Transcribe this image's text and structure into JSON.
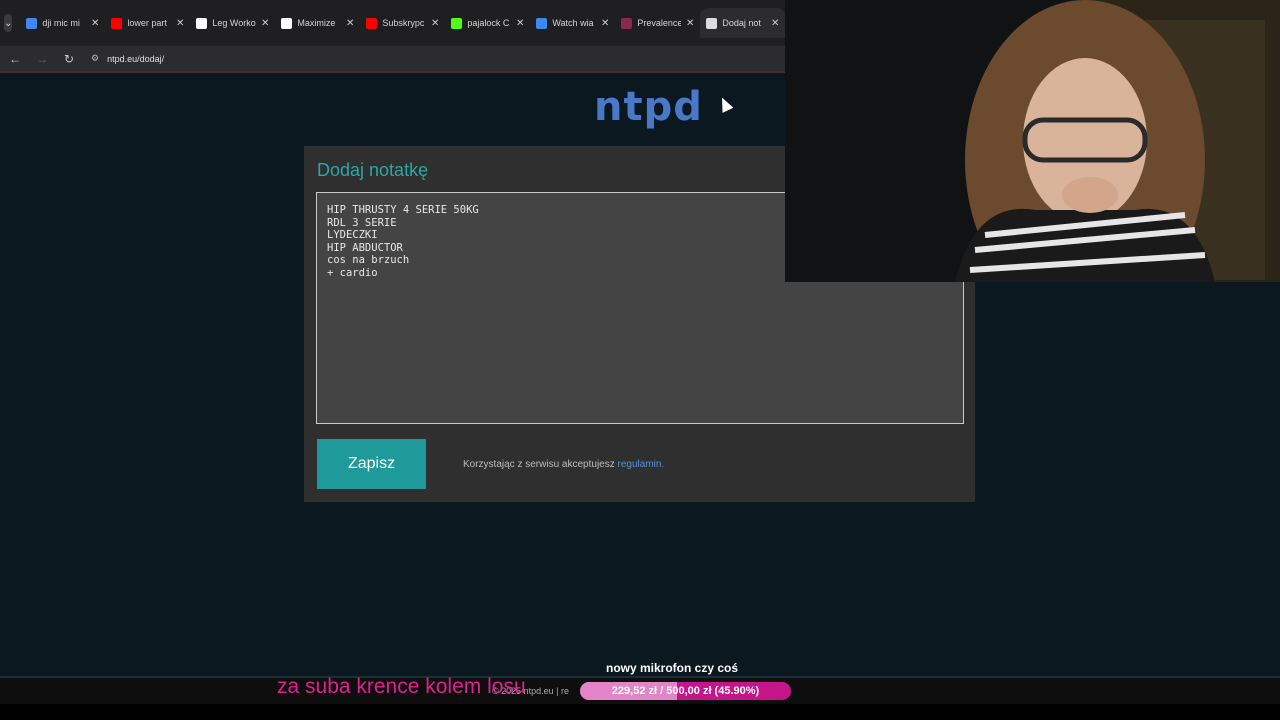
{
  "browser": {
    "tabs": [
      {
        "title": "dji mic mi",
        "favicon": "google-icon",
        "color": "#4285f4"
      },
      {
        "title": "lower part",
        "favicon": "youtube-icon",
        "color": "#ff0000"
      },
      {
        "title": "Leg Worko",
        "favicon": "tiktok-icon",
        "color": "#ffffff"
      },
      {
        "title": "Maximize",
        "favicon": "tiktok-icon",
        "color": "#ffffff"
      },
      {
        "title": "Subskrypc",
        "favicon": "youtube-icon",
        "color": "#ff0000"
      },
      {
        "title": "pajalock C",
        "favicon": "kick-icon",
        "color": "#53fc18"
      },
      {
        "title": "Watch wia",
        "favicon": "globe-icon",
        "color": "#3a8cf0"
      },
      {
        "title": "Prevalence",
        "favicon": "site-icon",
        "color": "#8a2a4a"
      },
      {
        "title": "Dodaj not",
        "favicon": "page-icon",
        "color": "#dddddd",
        "active": true
      }
    ],
    "close_glyph": "✕",
    "url": "ntpd.eu/dodaj/"
  },
  "page": {
    "logo": "ntpd",
    "card_title": "Dodaj notatkę",
    "note_lines": [
      "HIP THRUSTY 4 SERIE 50KG",
      "RDL 3 SERIE",
      "LYDECZKI",
      "HIP ABDUCTOR",
      "cos na brzuch",
      "+ cardio"
    ],
    "save_label": "Zapisz",
    "terms_text": "Korzystając z serwisu akceptujesz ",
    "terms_link": "regulamin."
  },
  "footer": {
    "text": "© 2025 ntpd.eu | re"
  },
  "stream_overlay": {
    "sub_text": "za suba krence kolem losu",
    "goal_title": "nowy mikrofon czy coś",
    "goal_label": "229,52 zł / 500,00 zł (45.90%)",
    "goal_fraction": 0.459
  }
}
